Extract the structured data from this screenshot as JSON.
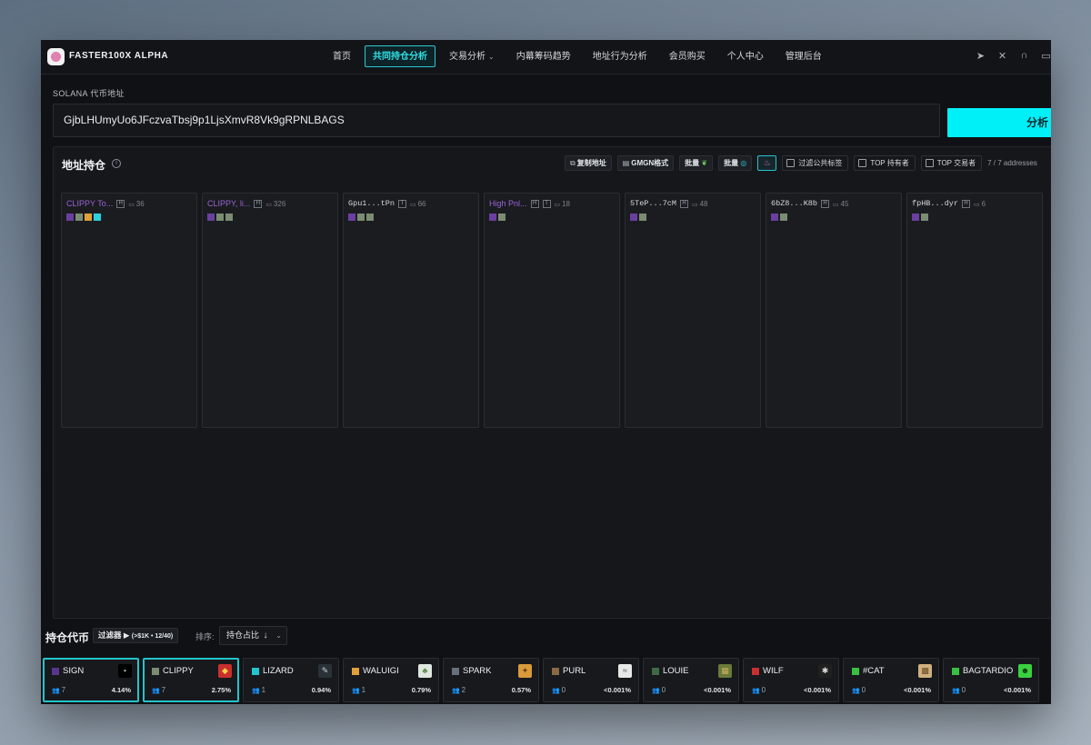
{
  "app": {
    "brand": "FASTER100X ALPHA"
  },
  "nav": [
    {
      "label": "首页"
    },
    {
      "label": "共同持仓分析",
      "active": true
    },
    {
      "label": "交易分析",
      "dropdown": true
    },
    {
      "label": "内幕筹码趋势"
    },
    {
      "label": "地址行为分析"
    },
    {
      "label": "会员购买"
    },
    {
      "label": "个人中心"
    },
    {
      "label": "管理后台"
    }
  ],
  "top_icons": [
    "telegram-icon",
    "x-icon",
    "headset-icon",
    "chat-icon"
  ],
  "address": {
    "label": "SOLANA 代币地址",
    "value": "GjbLHUmyUo6JFczvaTbsj9p1LjsXmvR8Vk9gRPNLBAGS",
    "search_label": "分析"
  },
  "holdings": {
    "title": "地址持仓",
    "tools": {
      "copy_label": "复制地址",
      "gmgn_label": "GMGN格式",
      "batch1_label": "批量",
      "batch2_label": "批量",
      "filter_public": "过滤公共标签",
      "top_holders": "TOP 持有者",
      "top_traders": "TOP 交易者",
      "count": "7 / 7 addresses"
    },
    "columns": [
      {
        "name": "CLIPPY To...",
        "tag": "H",
        "count": "36",
        "mono": false,
        "colors": [
          "#6a3fa0",
          "#7a8c72",
          "#e0a03a",
          "#2fd0dc"
        ]
      },
      {
        "name": "CLIPPY, li...",
        "tag": "H",
        "count": "326",
        "mono": false,
        "colors": [
          "#6a3fa0",
          "#7a8c72",
          "#7a8c72"
        ]
      },
      {
        "name": "Gpu1...tPn",
        "tag": "T",
        "count": "66",
        "mono": true,
        "colors": [
          "#6a3fa0",
          "#7a8c72",
          "#7a8c72"
        ]
      },
      {
        "name": "High Pnl...",
        "tag": "H",
        "tag2": "T",
        "count": "18",
        "mono": false,
        "colors": [
          "#6a3fa0",
          "#7a8c72"
        ]
      },
      {
        "name": "5TeP...7cM",
        "tag": "H",
        "count": "48",
        "mono": true,
        "colors": [
          "#6a3fa0",
          "#7a8c72"
        ]
      },
      {
        "name": "6bZ8...K8b",
        "tag": "H",
        "count": "45",
        "mono": true,
        "colors": [
          "#6a3fa0",
          "#7a8c72"
        ]
      },
      {
        "name": "fpHB...dyr",
        "tag": "H",
        "count": "6",
        "mono": true,
        "colors": [
          "#6a3fa0",
          "#7a8c72"
        ]
      }
    ]
  },
  "tokens_bar": {
    "title": "持仓代币",
    "filter_label": "过滤器 ▶",
    "filter_detail": "(>$1K • 12/40)",
    "sort_label": "排序:",
    "sort_value": "持仓占比",
    "sort_arrow": "↓",
    "tokens": [
      {
        "name": "SIGN",
        "holders": "7",
        "pct": "4.14%",
        "color": "#5a3590",
        "img_bg": "#000000",
        "img_fg": "#9aa0a8",
        "img_glyph": "▪",
        "selected": true
      },
      {
        "name": "CLIPPY",
        "holders": "7",
        "pct": "2.75%",
        "color": "#7a8c72",
        "img_bg": "#c8302c",
        "img_fg": "#ffd24a",
        "img_glyph": "◆",
        "selected": true
      },
      {
        "name": "LIZARD",
        "holders": "1",
        "pct": "0.94%",
        "color": "#23c5cc",
        "img_bg": "#2a3238",
        "img_fg": "#c9d1d8",
        "img_glyph": "✎"
      },
      {
        "name": "WALUIGI",
        "holders": "1",
        "pct": "0.79%",
        "color": "#e0a03a",
        "img_bg": "#dfe7df",
        "img_fg": "#5a8a4a",
        "img_glyph": "♣"
      },
      {
        "name": "SPARK",
        "holders": "2",
        "pct": "0.57%",
        "color": "#67707a",
        "img_bg": "#d89a3a",
        "img_fg": "#6a3a10",
        "img_glyph": "✦"
      },
      {
        "name": "PURL",
        "holders": "0",
        "pct": "<0.001%",
        "color": "#8a6a44",
        "img_bg": "#e8e8e8",
        "img_fg": "#555555",
        "img_glyph": "≈"
      },
      {
        "name": "LOUIE",
        "holders": "0",
        "pct": "<0.001%",
        "color": "#3f6a44",
        "img_bg": "#6a7a3a",
        "img_fg": "#c9b060",
        "img_glyph": "▦"
      },
      {
        "name": "WILF",
        "holders": "0",
        "pct": "<0.001%",
        "color": "#c83030",
        "img_bg": "#202020",
        "img_fg": "#dddddd",
        "img_glyph": "✱"
      },
      {
        "name": "#CAT",
        "holders": "0",
        "pct": "<0.001%",
        "color": "#3ac040",
        "img_bg": "#d0b080",
        "img_fg": "#6a4a20",
        "img_glyph": "▩"
      },
      {
        "name": "BAGTARDIO",
        "holders": "0",
        "pct": "<0.001%",
        "color": "#3ac040",
        "img_bg": "#3ad040",
        "img_fg": "#0a3a0a",
        "img_glyph": "☻"
      }
    ]
  }
}
